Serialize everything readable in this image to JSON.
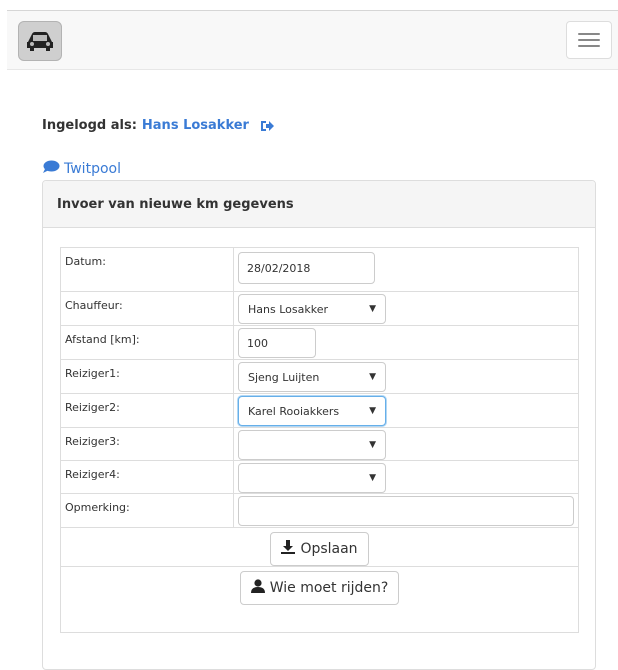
{
  "navbar": {
    "logo_icon": "car-icon",
    "menu_icon": "hamburger-icon"
  },
  "login": {
    "prefix": "Ingelogd als:",
    "user": "Hans Losakker",
    "logout_icon": "sign-out-icon"
  },
  "twitpool": {
    "icon": "comment-icon",
    "label": "Twitpool"
  },
  "panel": {
    "title": "Invoer van nieuwe km gegevens"
  },
  "form": {
    "datum_label": "Datum:",
    "datum_value": "28/02/2018",
    "chauffeur_label": "Chauffeur:",
    "chauffeur_value": "Hans Losakker",
    "afstand_label": "Afstand [km]:",
    "afstand_value": "100",
    "reiziger1_label": "Reiziger1:",
    "reiziger1_value": "Sjeng Luijten",
    "reiziger2_label": "Reiziger2:",
    "reiziger2_value": "Karel Rooiakkers",
    "reiziger3_label": "Reiziger3:",
    "reiziger3_value": "",
    "reiziger4_label": "Reiziger4:",
    "reiziger4_value": "",
    "opmerking_label": "Opmerking:",
    "opmerking_value": "",
    "save_label": "Opslaan",
    "save_icon": "download-icon",
    "who_label": "Wie moet rijden?",
    "who_icon": "user-icon"
  },
  "colors": {
    "link": "#3a7bd5",
    "focus": "#66afe9"
  }
}
